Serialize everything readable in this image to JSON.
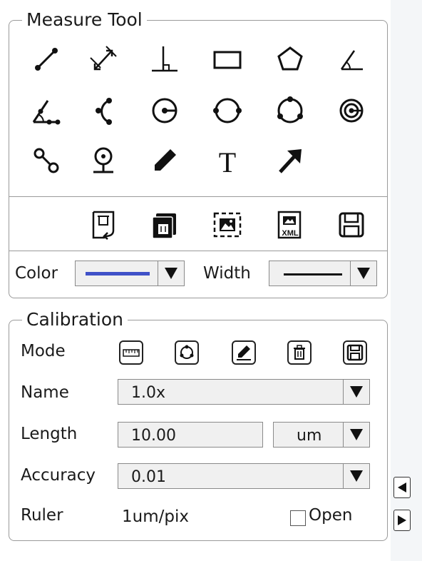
{
  "measure_tool": {
    "title": "Measure Tool",
    "color_label": "Color",
    "width_label": "Width",
    "color_value": "#3f51c8",
    "tools": [
      "line",
      "arrow-dimension",
      "perpendicular",
      "rectangle",
      "polygon",
      "angle",
      "angle-three-point",
      "arc",
      "circle-center-radius",
      "circle-two-point",
      "circle-three-point",
      "concentric-circles",
      "point-to-point",
      "point-marker",
      "pencil",
      "text",
      "arrow"
    ],
    "file_actions": [
      "undo-clear",
      "delete-all",
      "export-image",
      "export-xml",
      "save"
    ]
  },
  "calibration": {
    "title": "Calibration",
    "mode_label": "Mode",
    "name_label": "Name",
    "name_value": "1.0x",
    "length_label": "Length",
    "length_value": "10.00",
    "unit_value": "um",
    "accuracy_label": "Accuracy",
    "accuracy_value": "0.01",
    "ruler_label": "Ruler",
    "ruler_value": "1um/pix",
    "open_label": "Open",
    "open_checked": false
  }
}
